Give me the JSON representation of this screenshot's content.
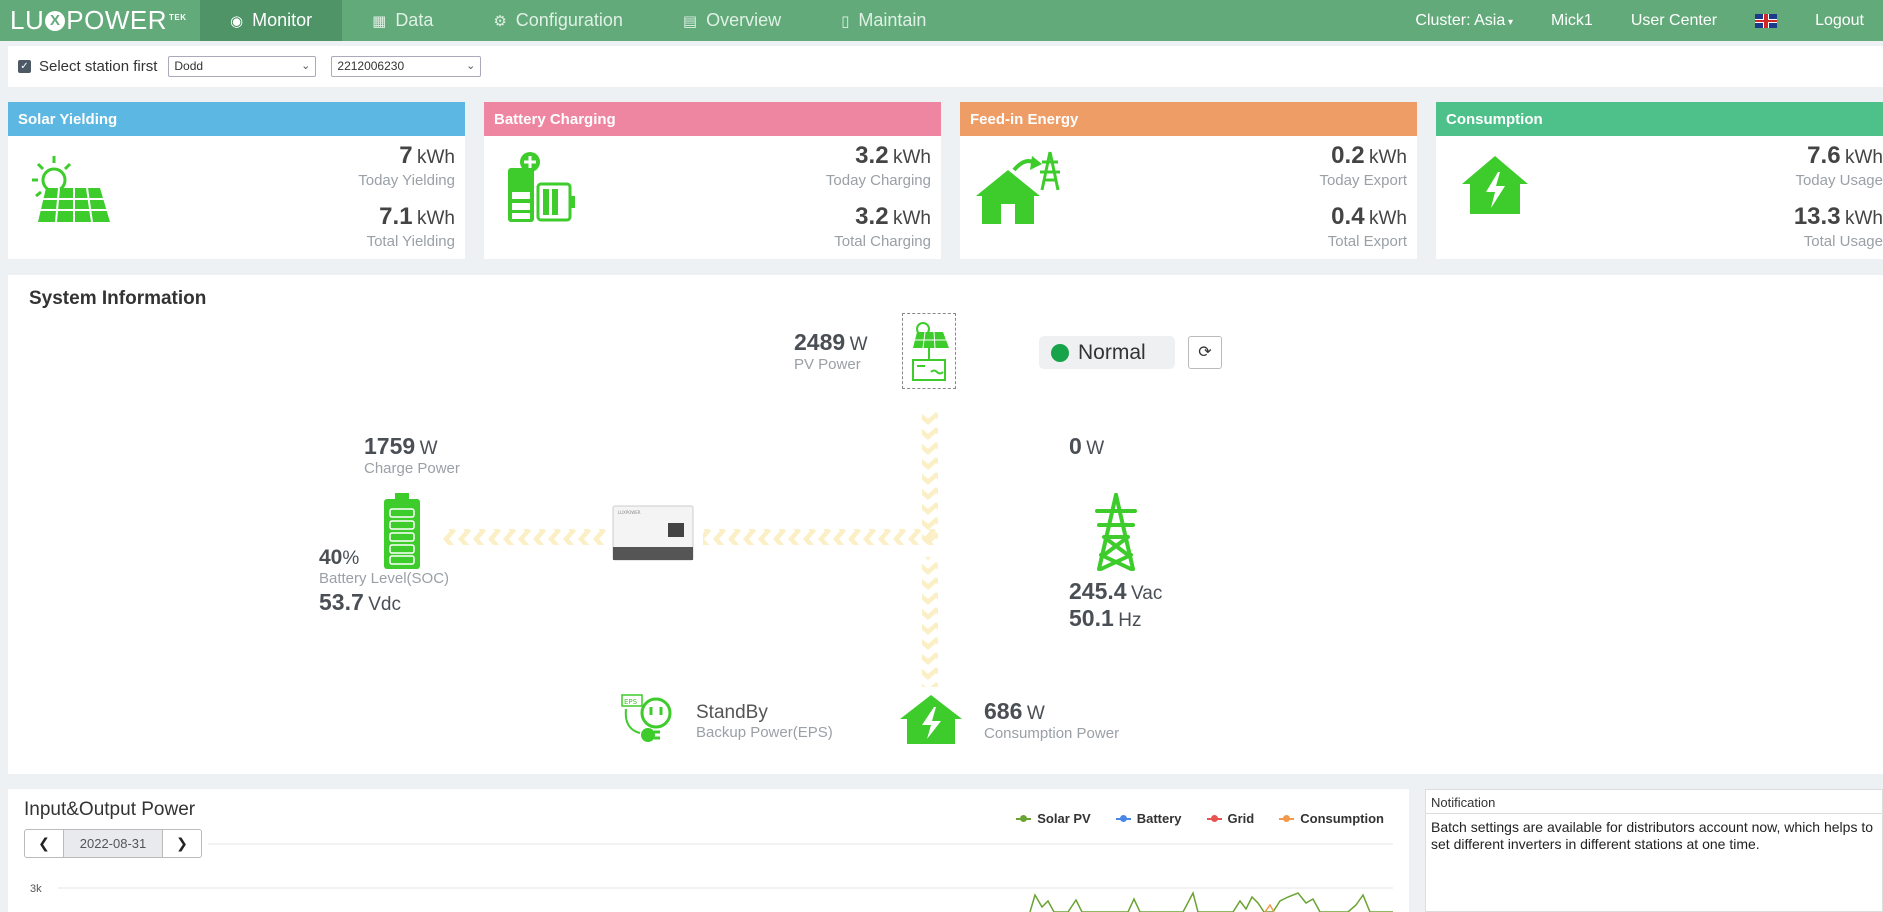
{
  "brand": {
    "logo_pre": "LU",
    "logo_x": "X",
    "logo_post": "POWER",
    "logo_sup": "TEK"
  },
  "nav": {
    "tabs": [
      {
        "label": "Monitor",
        "icon": "dashboard-icon"
      },
      {
        "label": "Data",
        "icon": "bar-chart-icon"
      },
      {
        "label": "Configuration",
        "icon": "cogs-icon"
      },
      {
        "label": "Overview",
        "icon": "book-icon"
      },
      {
        "label": "Maintain",
        "icon": "file-icon"
      }
    ],
    "cluster": "Cluster: Asia",
    "user": "Mick1",
    "user_center": "User Center",
    "logout": "Logout"
  },
  "station": {
    "checkbox_label": "Select station first",
    "station_name": "Dodd",
    "serial": "2212006230"
  },
  "cards": {
    "solar": {
      "title": "Solar Yielding",
      "color": "#5cb7e2",
      "today_value": "7",
      "today_label": "Today Yielding",
      "total_value": "7.1",
      "total_label": "Total Yielding",
      "unit": "kWh"
    },
    "battery": {
      "title": "Battery Charging",
      "color": "#ee86a1",
      "today_value": "3.2",
      "today_label": "Today Charging",
      "total_value": "3.2",
      "total_label": "Total Charging",
      "unit": "kWh"
    },
    "feedin": {
      "title": "Feed-in Energy",
      "color": "#ef9d66",
      "today_value": "0.2",
      "today_label": "Today Export",
      "total_value": "0.4",
      "total_label": "Total Export",
      "unit": "kWh"
    },
    "consumption": {
      "title": "Consumption",
      "color": "#4ec18a",
      "today_value": "7.6",
      "today_label": "Today Usage",
      "total_value": "13.3",
      "total_label": "Total Usage",
      "unit": "kWh"
    }
  },
  "system": {
    "title": "System Information",
    "pv_power": "2489",
    "pv_unit": "W",
    "pv_label": "PV Power",
    "status": "Normal",
    "charge_power": "1759",
    "charge_unit": "W",
    "charge_label": "Charge Power",
    "soc": "40",
    "soc_unit": "%",
    "soc_label": "Battery Level(SOC)",
    "battery_voltage": "53.7",
    "battery_voltage_unit": "Vdc",
    "grid_power": "0",
    "grid_unit": "W",
    "grid_voltage": "245.4",
    "grid_voltage_unit": "Vac",
    "grid_freq": "50.1",
    "grid_freq_unit": "Hz",
    "eps_status": "StandBy",
    "eps_label": "Backup Power(EPS)",
    "eps_tag": "EPS",
    "consumption_power": "686",
    "consumption_unit": "W",
    "consumption_label": "Consumption Power"
  },
  "io_chart": {
    "title": "Input&Output Power",
    "date": "2022-08-31",
    "y_tick": "3k",
    "legend": [
      {
        "name": "Solar PV",
        "color": "#6aa332"
      },
      {
        "name": "Battery",
        "color": "#4a86e8"
      },
      {
        "name": "Grid",
        "color": "#e55353"
      },
      {
        "name": "Consumption",
        "color": "#f19a4b"
      }
    ]
  },
  "notification": {
    "title": "Notification",
    "text": "Batch settings are available for distributors account now, which helps to set different inverters in different stations at one time."
  }
}
